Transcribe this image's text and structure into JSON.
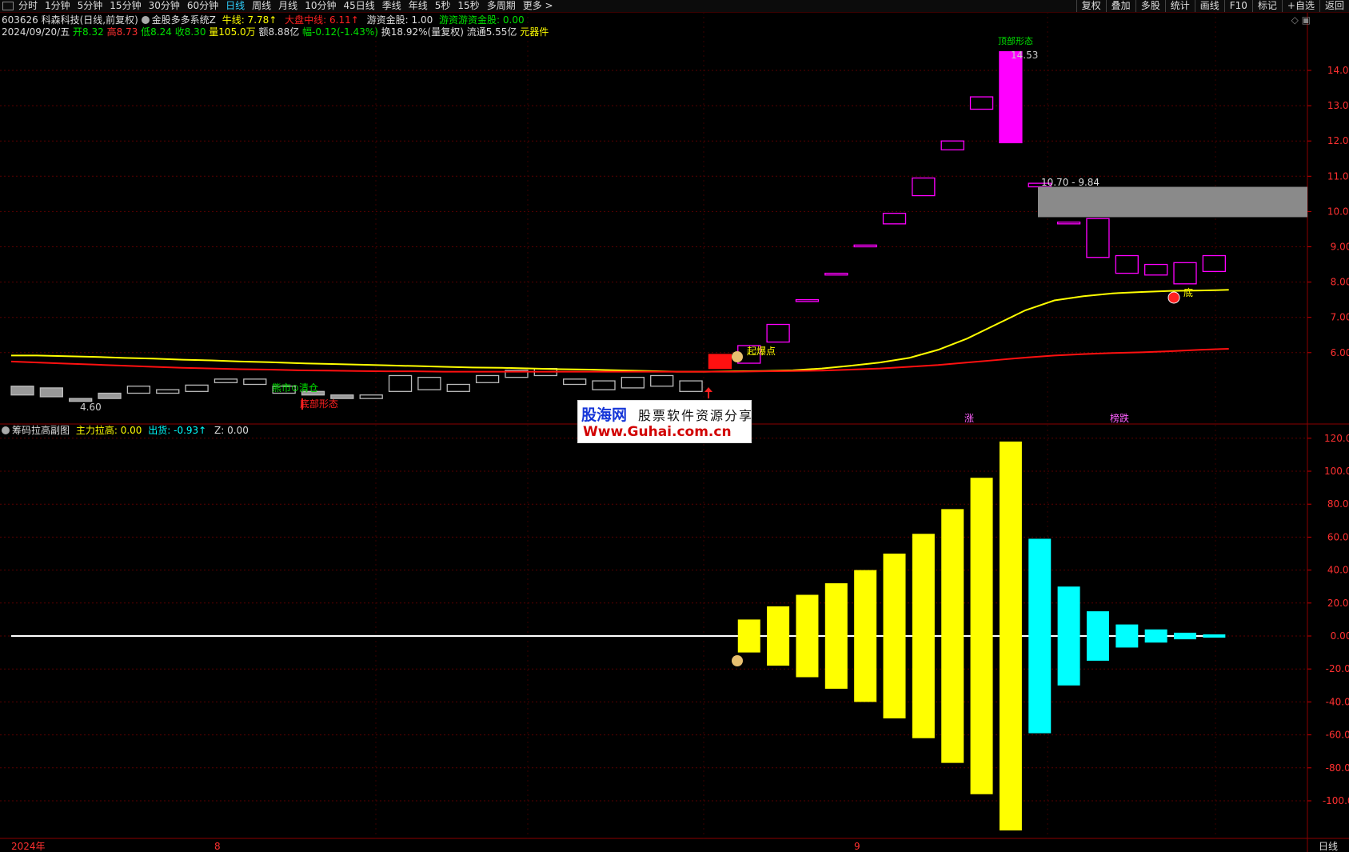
{
  "toolbar": {
    "periods": [
      "分时",
      "1分钟",
      "5分钟",
      "15分钟",
      "30分钟",
      "60分钟",
      "日线",
      "周线",
      "月线",
      "10分钟",
      "45日线",
      "季线",
      "年线",
      "5秒",
      "15秒",
      "多周期",
      "更多 >"
    ],
    "active_period": "日线",
    "right_menu": [
      "复权",
      "叠加",
      "多股",
      "统计",
      "画线",
      "F10",
      "标记",
      "+自选",
      "返回"
    ]
  },
  "header": {
    "stock": "603626 科森科技(日线,前复权)",
    "indicator": "金股多多系统Z",
    "bull_label": "牛线: 7.78↑",
    "market_label": "大盘中线: 6.11↑",
    "capital_label": "游资金股: 1.00",
    "hot_label": "游资游资金股: 0.00",
    "date": "2024/09/20/五",
    "open": "开8.32",
    "high": "高8.73",
    "low": "低8.24",
    "close": "收8.30",
    "volume": "量105.0万",
    "amount": "额8.88亿",
    "change": "幅-0.12(-1.43%)",
    "turnover": "换18.92%(量复权)",
    "float": "流通5.55亿",
    "concept": "元器件"
  },
  "sub_header": {
    "name": "筹码拉高副图",
    "lift": "主力拉高: 0.00",
    "ship": "出货: -0.93↑",
    "z": "Z: 0.00"
  },
  "annotations": {
    "low_price": "4.60",
    "bear_market": "熊市⊙清仓",
    "bottom_shape": "底部形态",
    "launch": "起爆点",
    "peak": "14.53",
    "range": "10.70 - 9.84",
    "bottom": "底",
    "zhang": "涨",
    "bang": "榜跌",
    "top_form": "顶部形态"
  },
  "axis": {
    "x_labels": [
      {
        "text": "2024年"
      },
      {
        "text": "8"
      },
      {
        "text": "9"
      }
    ],
    "period_tag": "日线"
  },
  "logo": {
    "line1a": "股海网",
    "line1b": "股票软件资源分享",
    "line2": "Www.Guhai.com.cn"
  },
  "colors": {
    "up": "#ff00ff",
    "down_flat": "#aaaaaa",
    "yellow": "#ffff00",
    "cyan": "#00ffff",
    "red": "#ff1010",
    "grid": "#5a0000"
  },
  "chart_data": [
    {
      "type": "candlestick",
      "y_ticks": [
        6.0,
        7.0,
        8.0,
        9.0,
        10.0,
        11.0,
        12.0,
        13.0,
        14.0
      ],
      "ylim": [
        4.2,
        15.1
      ],
      "candles": [
        {
          "o": 5.05,
          "c": 4.8
        },
        {
          "o": 5.0,
          "c": 4.75
        },
        {
          "o": 4.7,
          "c": 4.62
        },
        {
          "o": 4.85,
          "c": 4.7
        },
        {
          "o": 4.85,
          "c": 5.05
        },
        {
          "o": 4.85,
          "c": 4.95
        },
        {
          "o": 4.9,
          "c": 5.08
        },
        {
          "o": 5.15,
          "c": 5.25
        },
        {
          "o": 5.1,
          "c": 5.25
        },
        {
          "o": 4.85,
          "c": 5.05
        },
        {
          "o": 4.9,
          "c": 4.8
        },
        {
          "o": 4.8,
          "c": 4.7
        },
        {
          "o": 4.7,
          "c": 4.8
        },
        {
          "o": 4.9,
          "c": 5.35
        },
        {
          "o": 4.95,
          "c": 5.3
        },
        {
          "o": 4.9,
          "c": 5.1
        },
        {
          "o": 5.15,
          "c": 5.35
        },
        {
          "o": 5.3,
          "c": 5.5
        },
        {
          "o": 5.35,
          "c": 5.55
        },
        {
          "o": 5.1,
          "c": 5.25
        },
        {
          "o": 4.95,
          "c": 5.2
        },
        {
          "o": 5.0,
          "c": 5.3
        },
        {
          "o": 5.05,
          "c": 5.35
        },
        {
          "o": 4.9,
          "c": 5.2
        },
        {
          "o": 5.55,
          "c": 5.95,
          "color": "red"
        },
        {
          "o": 5.7,
          "c": 6.2
        },
        {
          "o": 6.3,
          "c": 6.8
        },
        {
          "o": 7.45,
          "c": 7.5
        },
        {
          "o": 8.2,
          "c": 8.25
        },
        {
          "o": 9.0,
          "c": 9.05
        },
        {
          "o": 9.65,
          "c": 9.95
        },
        {
          "o": 10.45,
          "c": 10.95
        },
        {
          "o": 11.75,
          "c": 12.0
        },
        {
          "o": 12.9,
          "c": 13.25
        },
        {
          "o": 11.95,
          "c": 14.53
        },
        {
          "o": 10.7,
          "c": 10.8
        },
        {
          "o": 9.65,
          "c": 9.7
        },
        {
          "o": 8.7,
          "c": 9.8
        },
        {
          "o": 8.25,
          "c": 8.75
        },
        {
          "o": 8.2,
          "c": 8.5
        },
        {
          "o": 7.95,
          "c": 8.55
        },
        {
          "o": 8.3,
          "c": 8.75
        }
      ],
      "bull_line": [
        5.92,
        5.92,
        5.9,
        5.88,
        5.85,
        5.83,
        5.8,
        5.78,
        5.75,
        5.73,
        5.7,
        5.68,
        5.66,
        5.64,
        5.62,
        5.6,
        5.58,
        5.57,
        5.55,
        5.53,
        5.52,
        5.5,
        5.48,
        5.46,
        5.46,
        5.47,
        5.48,
        5.5,
        5.55,
        5.63,
        5.72,
        5.85,
        6.08,
        6.4,
        6.8,
        7.2,
        7.48,
        7.6,
        7.68,
        7.72,
        7.75,
        7.76,
        7.78
      ],
      "market_line": [
        5.75,
        5.72,
        5.69,
        5.66,
        5.63,
        5.6,
        5.57,
        5.55,
        5.53,
        5.52,
        5.5,
        5.49,
        5.48,
        5.47,
        5.47,
        5.46,
        5.46,
        5.46,
        5.46,
        5.46,
        5.46,
        5.46,
        5.46,
        5.46,
        5.46,
        5.46,
        5.47,
        5.48,
        5.49,
        5.52,
        5.55,
        5.6,
        5.65,
        5.72,
        5.79,
        5.86,
        5.92,
        5.96,
        5.99,
        6.01,
        6.04,
        6.08,
        6.11
      ]
    },
    {
      "type": "bar",
      "y_ticks": [
        -100,
        -80,
        -60,
        -40,
        -20,
        0,
        20,
        40,
        60,
        80,
        100,
        120
      ],
      "ylim": [
        -125,
        128
      ],
      "lift_bars": [
        {
          "i": 25,
          "v": 10
        },
        {
          "i": 26,
          "v": 18
        },
        {
          "i": 27,
          "v": 25
        },
        {
          "i": 28,
          "v": 32
        },
        {
          "i": 29,
          "v": 40
        },
        {
          "i": 30,
          "v": 50
        },
        {
          "i": 31,
          "v": 62
        },
        {
          "i": 32,
          "v": 77
        },
        {
          "i": 33,
          "v": 96
        },
        {
          "i": 34,
          "v": 118
        }
      ],
      "ship_bars": [
        {
          "i": 35,
          "v": 59
        },
        {
          "i": 36,
          "v": 30
        },
        {
          "i": 37,
          "v": 15
        },
        {
          "i": 38,
          "v": 7
        },
        {
          "i": 39,
          "v": 4
        },
        {
          "i": 40,
          "v": 2
        },
        {
          "i": 41,
          "v": 1
        }
      ]
    }
  ]
}
